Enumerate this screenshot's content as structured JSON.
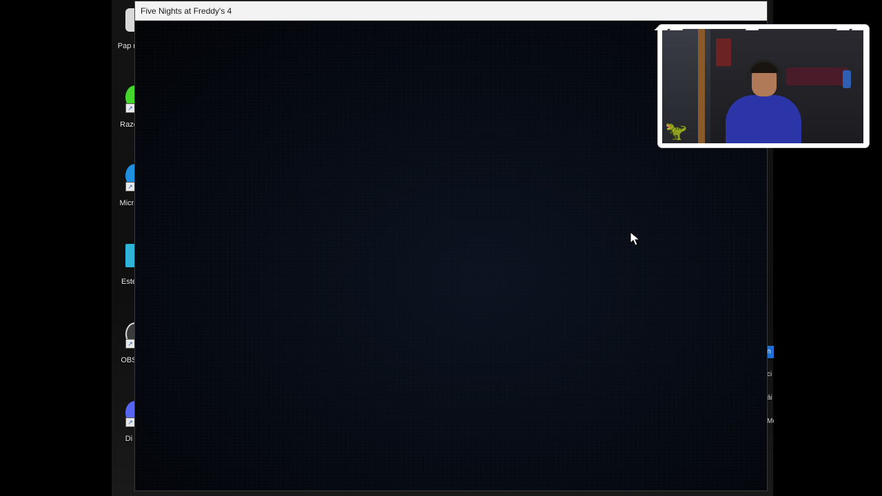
{
  "window": {
    "title": "Five Nights at Freddy's 4"
  },
  "desktop_icons": [
    {
      "label": "Pap re",
      "color": "#d9d9d9",
      "icon": "recycle-bin-icon"
    },
    {
      "label": "Raze",
      "color": "#44d62c",
      "icon": "razer-icon"
    },
    {
      "label": "Micro",
      "color": "#1f8fe0",
      "icon": "edge-icon"
    },
    {
      "label": "Este",
      "color": "#2fb3d6",
      "icon": "this-pc-icon"
    },
    {
      "label": "OBS",
      "color": "#3a3a3a",
      "icon": "obs-icon"
    },
    {
      "label": "Di",
      "color": "#5865f2",
      "icon": "discord-icon"
    }
  ],
  "right_peek": [
    "n",
    "ci",
    "ái",
    "Mc"
  ],
  "colors": {
    "titlebar": "#f3f3f3",
    "game_bg": "#060a12",
    "accent": "#1f6fd1"
  }
}
